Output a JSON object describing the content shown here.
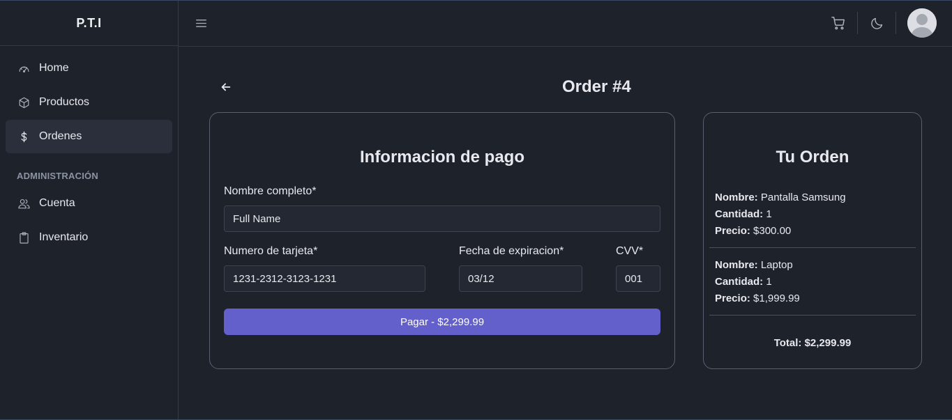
{
  "brand": "P.T.I",
  "sidebar": {
    "items": [
      {
        "label": "Home",
        "icon": "dashboard-gauge-icon"
      },
      {
        "label": "Productos",
        "icon": "box-icon"
      },
      {
        "label": "Ordenes",
        "icon": "dollar-icon",
        "active": true
      }
    ],
    "section_label": "ADMINISTRACIÓN",
    "admin_items": [
      {
        "label": "Cuenta",
        "icon": "users-icon"
      },
      {
        "label": "Inventario",
        "icon": "clipboard-icon"
      }
    ]
  },
  "topbar": {
    "icons": [
      "menu-icon",
      "cart-icon",
      "moon-icon",
      "avatar"
    ]
  },
  "page": {
    "title": "Order #4"
  },
  "payment": {
    "title": "Informacion de pago",
    "name_label": "Nombre completo*",
    "name_value": "Full Name",
    "card_label": "Numero de tarjeta*",
    "card_value": "1231-2312-3123-1231",
    "exp_label": "Fecha de expiracion*",
    "exp_value": "03/12",
    "cvv_label": "CVV*",
    "cvv_value": "001",
    "pay_button": "Pagar - $2,299.99"
  },
  "order": {
    "title": "Tu Orden",
    "name_key": "Nombre:",
    "qty_key": "Cantidad:",
    "price_key": "Precio:",
    "items": [
      {
        "name": "Pantalla Samsung",
        "qty": "1",
        "price": "$300.00"
      },
      {
        "name": "Laptop",
        "qty": "1",
        "price": "$1,999.99"
      }
    ],
    "total": "Total: $2,299.99"
  },
  "colors": {
    "background": "#1e222b",
    "accent": "#6360cb",
    "border": "#5a6070"
  }
}
